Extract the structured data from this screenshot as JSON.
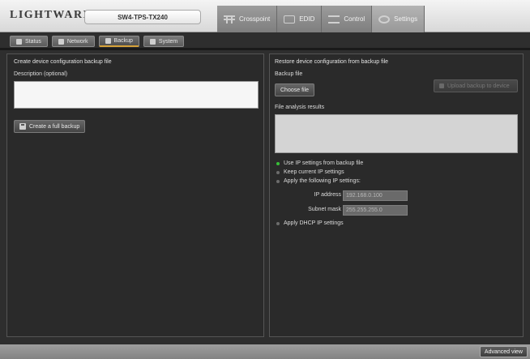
{
  "header": {
    "logo": "LIGHTWARE",
    "device_name": "SW4-TPS-TX240",
    "tabs": [
      {
        "label": "Crosspoint",
        "icon": "crosspoint-icon"
      },
      {
        "label": "EDID",
        "icon": "edid-icon"
      },
      {
        "label": "Control",
        "icon": "control-icon"
      },
      {
        "label": "Settings",
        "icon": "settings-icon",
        "active": true
      }
    ]
  },
  "subtabs": [
    {
      "label": "Status",
      "icon": "status-icon"
    },
    {
      "label": "Network",
      "icon": "network-icon"
    },
    {
      "label": "Backup",
      "icon": "backup-icon",
      "active": true
    },
    {
      "label": "System",
      "icon": "system-icon"
    }
  ],
  "backup": {
    "title": "Create device configuration backup file",
    "description_label": "Description (optional)",
    "description_value": "",
    "create_button": "Create a full backup"
  },
  "restore": {
    "title": "Restore device configuration from backup file",
    "backup_file_label": "Backup file",
    "choose_file_button": "Choose file",
    "upload_button": "Upload backup to device",
    "results_label": "File analysis results",
    "options": [
      {
        "label": "Use IP settings from backup file",
        "selected": true
      },
      {
        "label": "Keep current IP settings",
        "selected": false
      },
      {
        "label": "Apply the following IP settings:",
        "selected": false
      }
    ],
    "ip_address_label": "IP address",
    "ip_address_value": "192.168.0.100",
    "subnet_mask_label": "Subnet mask",
    "subnet_mask_value": "255.255.255.0",
    "dhcp_option": {
      "label": "Apply DHCP IP settings",
      "selected": false
    }
  },
  "footer": {
    "advanced_view": "Advanced view"
  },
  "colors": {
    "active_radio": "#38c038",
    "tab_accent": "#d6a23a",
    "panel_bg": "#2a2a2a"
  }
}
